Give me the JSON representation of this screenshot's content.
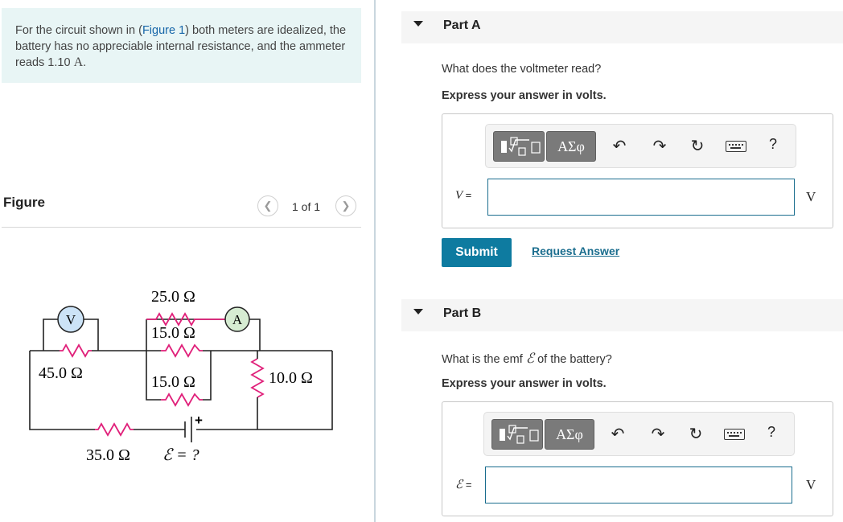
{
  "problem": {
    "text_before": "For the circuit shown in (",
    "figure_link": "Figure 1",
    "text_after": ") both meters are idealized, the battery has no appreciable internal resistance, and the ammeter reads 1.10 ",
    "unit": "A",
    "period": "."
  },
  "figure": {
    "title": "Figure",
    "page": "1 of 1",
    "prev_icon": "chevron-left-icon",
    "next_icon": "chevron-right-icon",
    "circuit": {
      "voltmeter": "V",
      "ammeter": "A",
      "r_top": "25.0 Ω",
      "r_mid_top": "15.0 Ω",
      "r_left": "45.0 Ω",
      "r_mid_bottom": "15.0 Ω",
      "r_right": "10.0 Ω",
      "r_bottom": "35.0 Ω",
      "battery_plus": "+",
      "emf": "ℰ = ?"
    }
  },
  "partA": {
    "title": "Part A",
    "question": "What does the voltmeter read?",
    "express": "Express your answer in volts.",
    "templates_icon": "fraction-root-icon",
    "greek_label": "ΑΣφ",
    "var": "V",
    "eq": "=",
    "input_value": "",
    "unit": "V",
    "submit": "Submit",
    "request": "Request Answer",
    "help": "?"
  },
  "partB": {
    "title": "Part B",
    "question_before": "What is the emf ",
    "question_symbol": "ℰ",
    "question_after": " of the battery?",
    "express": "Express your answer in volts.",
    "greek_label": "ΑΣφ",
    "var": "ℰ",
    "eq": "=",
    "input_value": "",
    "unit": "V",
    "help": "?"
  },
  "colors": {
    "accent": "#0e7ba0",
    "link": "#1565a8",
    "problem_bg": "#e8f5f5",
    "resistor": "#e0207a",
    "voltmeter_fill": "#cce3f7",
    "ammeter_fill": "#d6ecd2"
  }
}
